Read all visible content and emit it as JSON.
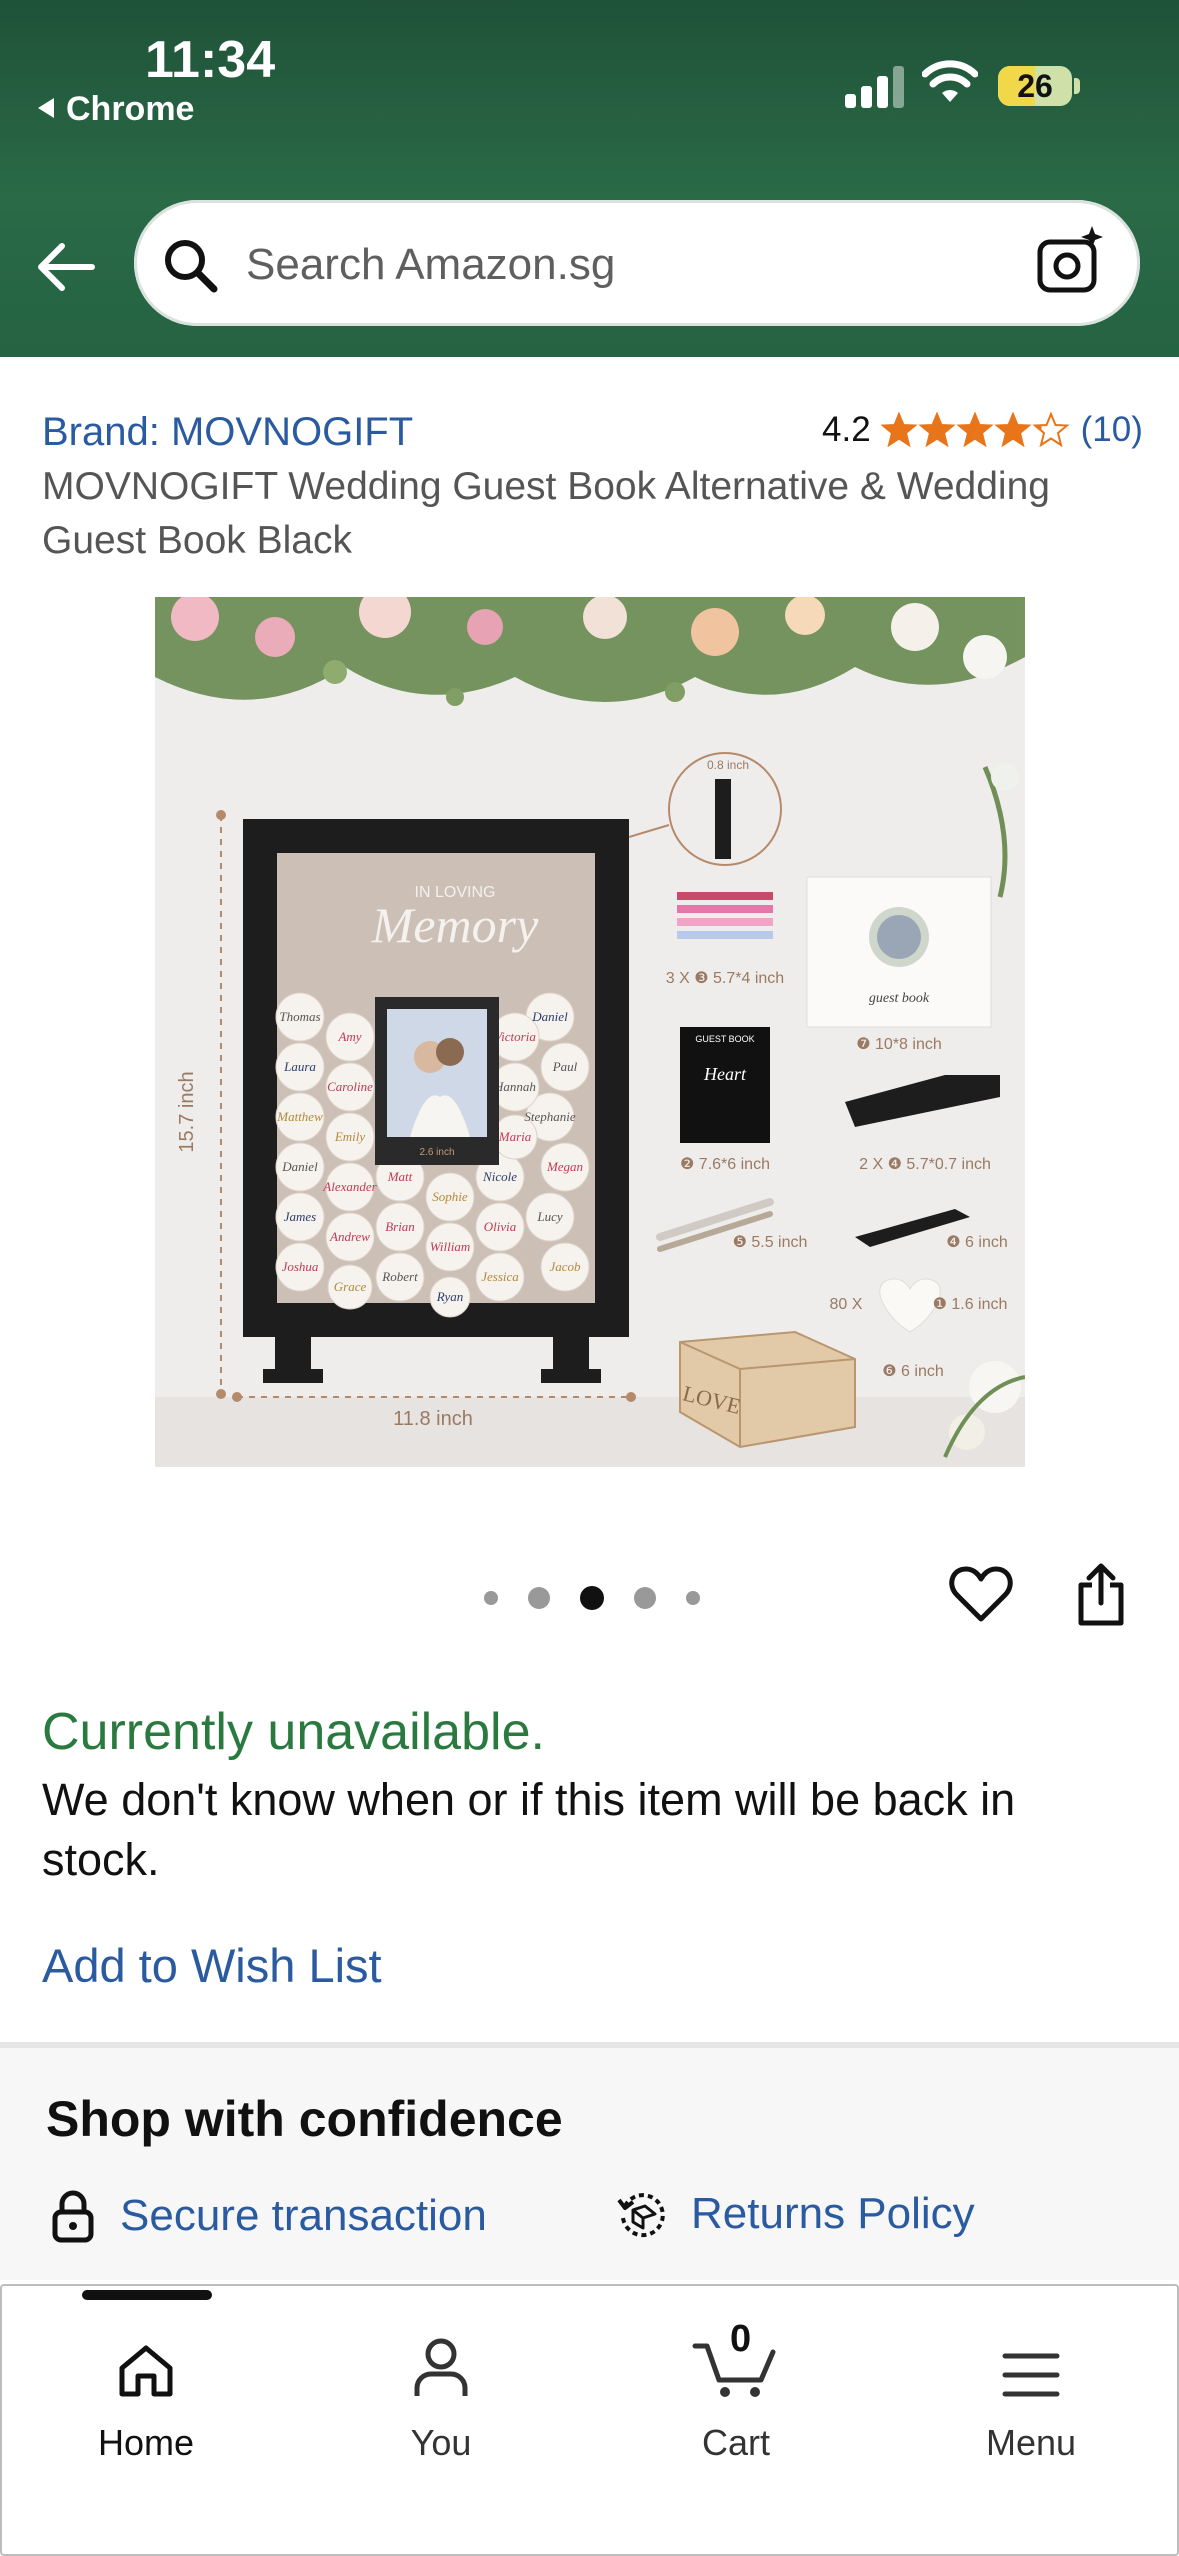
{
  "status_bar": {
    "time": "11:34",
    "back_app": "Chrome",
    "battery": "26"
  },
  "search": {
    "placeholder": "Search Amazon.sg"
  },
  "product": {
    "brand": "Brand: MOVNOGIFT",
    "rating": "4.2",
    "rating_stars": 4.2,
    "review_count": "(10)",
    "title": "MOVNOGIFT Wedding Guest Book Alternative & Wedding Guest Book Black"
  },
  "product_image": {
    "frame_text_small": "IN LOVING",
    "frame_text_big": "Memory",
    "photo_label": "2.6 inch",
    "height_label": "15.7 inch",
    "width_label": "11.8 inch",
    "depth_label": "0.8 inch",
    "ribbons_label": "3 X ❸ 5.7*4 inch",
    "book_label": "❼ 10*8 inch",
    "book_title": "guest book",
    "sign_label": "❷ 7.6*6 inch",
    "sign_header": "GUEST BOOK",
    "sign_heart": "Heart",
    "stands_label": "2 X ❹ 5.7*0.7 inch",
    "pens_label": "❺ 5.5 inch",
    "base_label": "❹ 6 inch",
    "hearts_label": "80 X",
    "heart_size_label": "❶ 1.6 inch",
    "box_label": "❻ 6 inch",
    "box_word": "LOVE",
    "hearts_names": [
      "Thomas",
      "Amy",
      "Daniel",
      "Paul",
      "Laura",
      "Caroline",
      "Victoria",
      "Stephanie",
      "Matthew",
      "Emily",
      "Hannah",
      "Maria",
      "Daniel",
      "Alexander",
      "Nicole",
      "Megan",
      "James",
      "Andrew",
      "Matt",
      "Olivia",
      "Brian",
      "Sophie",
      "Robert",
      "William",
      "Jessica",
      "Joshua",
      "Lucy",
      "Jacob",
      "Grace",
      "Ryan"
    ]
  },
  "carousel": {
    "count": 5,
    "active": 2
  },
  "availability": {
    "status": "Currently unavailable.",
    "message": "We don't know when or if this item will be back in stock."
  },
  "wishlist": {
    "label": "Add to Wish List"
  },
  "confidence": {
    "title": "Shop with confidence",
    "secure": "Secure transaction",
    "returns": "Returns Policy"
  },
  "tabs": [
    {
      "label": "Home",
      "icon": "home-icon"
    },
    {
      "label": "You",
      "icon": "person-icon"
    },
    {
      "label": "Cart",
      "icon": "cart-icon",
      "badge": "0"
    },
    {
      "label": "Menu",
      "icon": "menu-icon"
    }
  ],
  "colors": {
    "header": "#25603f",
    "link": "#2a5aa0",
    "available": "#2a7a3f",
    "star": "#e8751a"
  }
}
